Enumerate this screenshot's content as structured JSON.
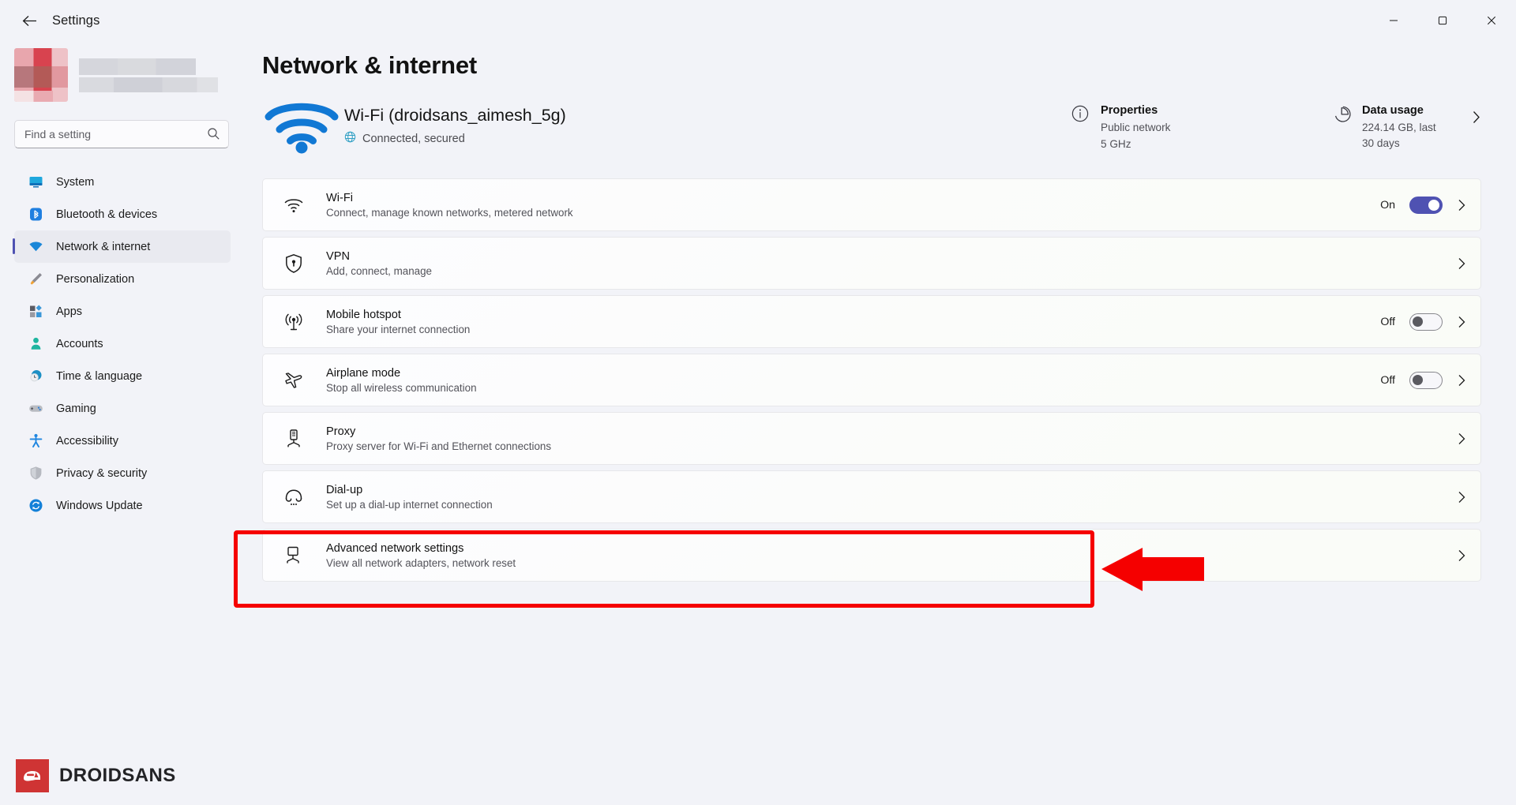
{
  "window": {
    "app_title": "Settings",
    "back_icon": "back-arrow-icon",
    "minimize_glyph": "─",
    "maximize_glyph": "❐",
    "close_glyph": "✕"
  },
  "sidebar": {
    "account_name_blurred": "",
    "search": {
      "placeholder": "Find a setting",
      "value": "",
      "icon": "search-icon"
    },
    "items": [
      {
        "label": "System",
        "icon": "monitor-icon",
        "active": false
      },
      {
        "label": "Bluetooth & devices",
        "icon": "bluetooth-icon",
        "active": false
      },
      {
        "label": "Network & internet",
        "icon": "wifi-icon",
        "active": true
      },
      {
        "label": "Personalization",
        "icon": "paintbrush-icon",
        "active": false
      },
      {
        "label": "Apps",
        "icon": "apps-grid-icon",
        "active": false
      },
      {
        "label": "Accounts",
        "icon": "person-icon",
        "active": false
      },
      {
        "label": "Time & language",
        "icon": "clock-globe-icon",
        "active": false
      },
      {
        "label": "Gaming",
        "icon": "gamepad-icon",
        "active": false
      },
      {
        "label": "Accessibility",
        "icon": "accessibility-person-icon",
        "active": false
      },
      {
        "label": "Privacy & security",
        "icon": "shield-icon",
        "active": false
      },
      {
        "label": "Windows Update",
        "icon": "update-refresh-icon",
        "active": false
      }
    ]
  },
  "main": {
    "page_title": "Network & internet",
    "connection": {
      "icon": "wifi-signal-icon",
      "name": "Wi-Fi (droidsans_aimesh_5g)",
      "status": "Connected, secured",
      "status_icon": "globe-icon"
    },
    "properties": {
      "icon": "info-circle-icon",
      "title": "Properties",
      "line1": "Public network",
      "line2": "5 GHz"
    },
    "data_usage": {
      "icon": "pie-chart-icon",
      "title": "Data usage",
      "subtitle": "224.14 GB, last 30 days",
      "chevron": "chevron-right-icon"
    },
    "rows": [
      {
        "icon": "wifi-icon",
        "title": "Wi-Fi",
        "subtitle": "Connect, manage known networks, metered network",
        "toggle": {
          "state": "on",
          "label": "On"
        },
        "chevron": "chevron-right-icon"
      },
      {
        "icon": "vpn-shield-icon",
        "title": "VPN",
        "subtitle": "Add, connect, manage",
        "toggle": null,
        "chevron": "chevron-right-icon"
      },
      {
        "icon": "hotspot-broadcast-icon",
        "title": "Mobile hotspot",
        "subtitle": "Share your internet connection",
        "toggle": {
          "state": "off",
          "label": "Off"
        },
        "chevron": "chevron-right-icon"
      },
      {
        "icon": "airplane-icon",
        "title": "Airplane mode",
        "subtitle": "Stop all wireless communication",
        "toggle": {
          "state": "off",
          "label": "Off"
        },
        "chevron": "chevron-right-icon"
      },
      {
        "icon": "proxy-server-icon",
        "title": "Proxy",
        "subtitle": "Proxy server for Wi-Fi and Ethernet connections",
        "toggle": null,
        "chevron": "chevron-right-icon"
      },
      {
        "icon": "dialup-phone-icon",
        "title": "Dial-up",
        "subtitle": "Set up a dial-up internet connection",
        "toggle": null,
        "chevron": "chevron-right-icon"
      },
      {
        "icon": "advanced-network-monitor-icon",
        "title": "Advanced network settings",
        "subtitle": "View all network adapters, network reset",
        "toggle": null,
        "chevron": "chevron-right-icon"
      }
    ]
  },
  "annotation": {
    "highlight_color": "#f50000",
    "arrow_color": "#f50000",
    "target_row_title": "Advanced network settings"
  },
  "watermark": {
    "text": "DROIDSANS",
    "mark_color": "#cf3434"
  }
}
